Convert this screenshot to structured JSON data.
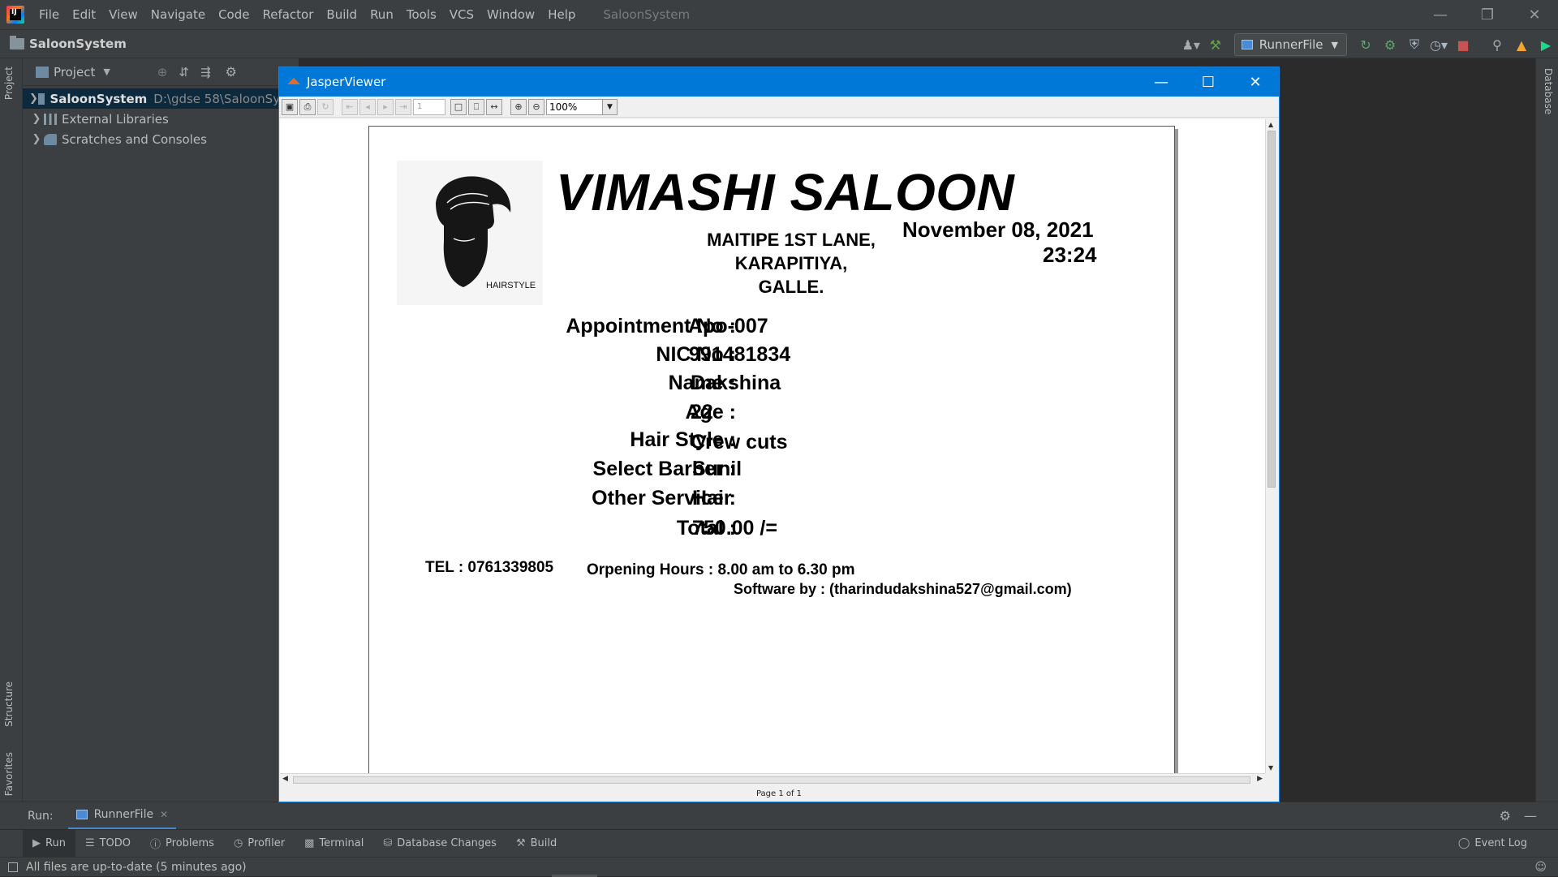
{
  "ide": {
    "menu": [
      "File",
      "Edit",
      "View",
      "Navigate",
      "Code",
      "Refactor",
      "Build",
      "Run",
      "Tools",
      "VCS",
      "Window",
      "Help"
    ],
    "window_title": "SaloonSystem",
    "project_name": "SaloonSystem",
    "run_config": "RunnerFile"
  },
  "project_panel": {
    "title": "Project",
    "tree": [
      {
        "label": "SaloonSystem",
        "path": "D:\\gdse 58\\SaloonSyste"
      },
      {
        "label": "External Libraries"
      },
      {
        "label": "Scratches and Consoles"
      }
    ]
  },
  "side_tabs": {
    "project": "Project",
    "structure": "Structure",
    "favorites": "Favorites",
    "database": "Database"
  },
  "run_panel": {
    "label": "Run:",
    "tab": "RunnerFile"
  },
  "tool_windows": [
    "Run",
    "TODO",
    "Problems",
    "Profiler",
    "Terminal",
    "Database Changes",
    "Build"
  ],
  "event_log": "Event Log",
  "status_text": "All files are up-to-date (5 minutes ago)",
  "jasper": {
    "title": "JasperViewer",
    "page_field": "1",
    "zoom": "100%",
    "page_status": "Page 1 of 1"
  },
  "report": {
    "logo_caption": "HAIRSTYLE",
    "title": "VIMASHI SALOON",
    "address": [
      "MAITIPE 1ST LANE,",
      "KARAPITIYA,",
      "GALLE."
    ],
    "date": "November 08, 2021",
    "time": "23:24",
    "fields": [
      {
        "label": "Appointment No :",
        "value": "Apo-007"
      },
      {
        "label": "NIC No :",
        "value": "991481834"
      },
      {
        "label": "Name :",
        "value": "Dakshina"
      },
      {
        "label": "Age :",
        "value": "22"
      },
      {
        "label": "Hair Style :",
        "value": "Crew cuts"
      },
      {
        "label": "Select Barber :",
        "value": "Sunil"
      },
      {
        "label": "Other Service :",
        "value": "Hair"
      },
      {
        "label": "Total :",
        "value": "750.00 /="
      }
    ],
    "tel": "TEL : 0761339805",
    "hours": "Orpening Hours : 8.00 am to 6.30 pm",
    "software_by": "Software by : (tharindudakshina527@gmail.com)"
  }
}
